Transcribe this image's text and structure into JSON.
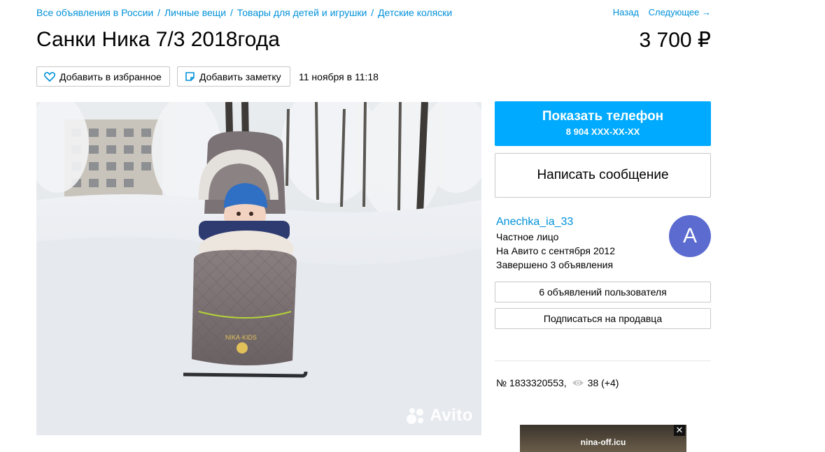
{
  "breadcrumb": {
    "items": [
      "Все объявления в России",
      "Личные вещи",
      "Товары для детей и игрушки",
      "Детские коляски"
    ],
    "separator": "/"
  },
  "nav": {
    "back": "Назад",
    "next": "Следующее →"
  },
  "listing": {
    "title": "Санки Ника 7/3 2018года",
    "price": "3 700 ₽",
    "date": "11 ноября в 11:18",
    "number": "№ 1833320553,",
    "views": "38 (+4)"
  },
  "actions": {
    "favorite": "Добавить в избранное",
    "note": "Добавить заметку"
  },
  "photo": {
    "watermark": "Avito"
  },
  "contact": {
    "show_phone": "Показать телефон",
    "phone_masked": "8 904 XXX-XX-XX",
    "write_message": "Написать сообщение"
  },
  "seller": {
    "name": "Anechka_ia_33",
    "type": "Частное лицо",
    "since": "На Авито с сентября 2012",
    "completed": "Завершено 3 объявления",
    "avatar_letter": "A",
    "all_ads_button": "6 объявлений пользователя",
    "subscribe_button": "Подписаться на продавца"
  },
  "ad": {
    "label": "nina-off.icu",
    "close": "✕"
  },
  "colors": {
    "link": "#0091d9",
    "primary": "#00aaff",
    "avatar": "#5b6bd0"
  }
}
